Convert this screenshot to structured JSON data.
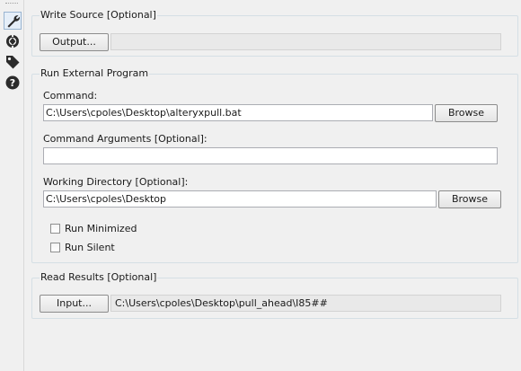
{
  "sidebar": {
    "icons": [
      "wrench-icon",
      "target-icon",
      "tag-icon",
      "help-icon"
    ]
  },
  "write_source": {
    "title": "Write Source [Optional]",
    "output_button": "Output...",
    "output_value": ""
  },
  "run_external": {
    "title": "Run External Program",
    "command_label": "Command:",
    "command_value": "C:\\Users\\cpoles\\Desktop\\alteryxpull.bat",
    "browse_label": "Browse",
    "arguments_label": "Command Arguments [Optional]:",
    "arguments_value": "",
    "working_dir_label": "Working Directory [Optional]:",
    "working_dir_value": "C:\\Users\\cpoles\\Desktop",
    "browse2_label": "Browse",
    "run_minimized_label": "Run Minimized",
    "run_silent_label": "Run Silent"
  },
  "read_results": {
    "title": "Read Results [Optional]",
    "input_button": "Input...",
    "input_value": "C:\\Users\\cpoles\\Desktop\\pull_ahead\\I85##"
  }
}
